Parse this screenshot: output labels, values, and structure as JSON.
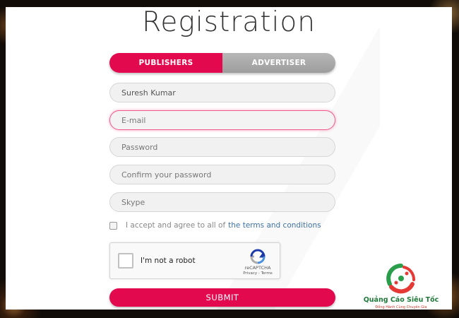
{
  "page": {
    "title": "Registration"
  },
  "tabs": [
    {
      "label": "PUBLISHERS",
      "active": true
    },
    {
      "label": "ADVERTISER",
      "active": false
    }
  ],
  "form": {
    "name_value": "Suresh Kumar",
    "email_placeholder": "E-mail",
    "password_placeholder": "Password",
    "confirm_placeholder": "Confirm your password",
    "skype_placeholder": "Skype",
    "terms_text": "I accept and agree to all of",
    "terms_link": "the terms and conditions",
    "submit_label": "SUBMIT"
  },
  "recaptcha": {
    "label": "I'm not a robot",
    "brand": "reCAPTCHA",
    "links": "Privacy - Terms"
  },
  "watermark": {
    "name": "Quảng Cáo Siêu Tốc",
    "tagline": "Đồng Hành Cùng Chuyên Gia"
  },
  "colors": {
    "accent": "#e3094f",
    "inactive_tab": "#a8a8a8",
    "link": "#3f72a6"
  },
  "icons": [
    "recaptcha-logo-icon",
    "watermark-logo-icon"
  ]
}
